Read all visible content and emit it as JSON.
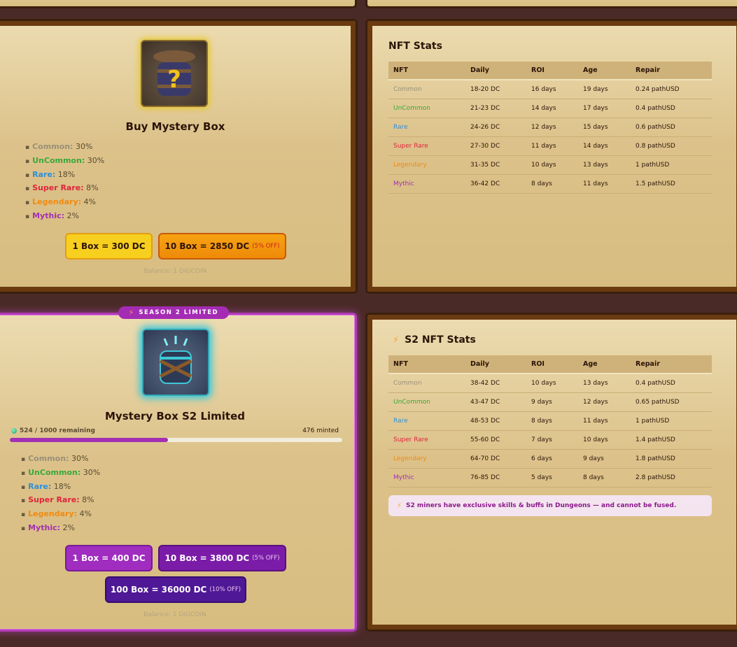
{
  "colors": {
    "common": "#9a9078",
    "uncommon": "#3aa83a",
    "rare": "#2d8fd6",
    "super_rare": "#e0243c",
    "legendary": "#f08a10",
    "mythic": "#a32fb4"
  },
  "box1": {
    "icon": "mystery-barrel-icon",
    "title": "Buy Mystery Box",
    "rarities": [
      {
        "name": "Common:",
        "pct": "30%"
      },
      {
        "name": "UnCommon:",
        "pct": "30%"
      },
      {
        "name": "Rare:",
        "pct": "18%"
      },
      {
        "name": "Super Rare:",
        "pct": "8%"
      },
      {
        "name": "Legendary:",
        "pct": "4%"
      },
      {
        "name": "Mythic:",
        "pct": "2%"
      }
    ],
    "btn_1": "1 Box = 300 DC",
    "btn_10": "10 Box = 2850 DC",
    "btn_10_discount": "(5% OFF)",
    "balance": "Balance: 1 DIGCOIN"
  },
  "stats1": {
    "title": "NFT Stats",
    "headers": [
      "NFT",
      "Daily",
      "ROI",
      "Age",
      "Repair"
    ],
    "rows": [
      [
        "Common",
        "18-20 DC",
        "16 days",
        "19 days",
        "0.24 pathUSD"
      ],
      [
        "UnCommon",
        "21-23 DC",
        "14 days",
        "17 days",
        "0.4 pathUSD"
      ],
      [
        "Rare",
        "24-26 DC",
        "12 days",
        "15 days",
        "0.6 pathUSD"
      ],
      [
        "Super Rare",
        "27-30 DC",
        "11 days",
        "14 days",
        "0.8 pathUSD"
      ],
      [
        "Legendary",
        "31-35 DC",
        "10 days",
        "13 days",
        "1 pathUSD"
      ],
      [
        "Mythic",
        "36-42 DC",
        "8 days",
        "11 days",
        "1.5 pathUSD"
      ]
    ]
  },
  "box2": {
    "badge": "SEASON 2 LIMITED",
    "icon": "chained-barrel-icon",
    "title": "Mystery Box S2 Limited",
    "remaining": "524 / 1000 remaining",
    "minted": "476 minted",
    "progress_fraction": 0.476,
    "rarities": [
      {
        "name": "Common:",
        "pct": "30%"
      },
      {
        "name": "UnCommon:",
        "pct": "30%"
      },
      {
        "name": "Rare:",
        "pct": "18%"
      },
      {
        "name": "Super Rare:",
        "pct": "8%"
      },
      {
        "name": "Legendary:",
        "pct": "4%"
      },
      {
        "name": "Mythic:",
        "pct": "2%"
      }
    ],
    "btn_1": "1 Box = 400 DC",
    "btn_10": "10 Box = 3800 DC",
    "btn_10_discount": "(5% OFF)",
    "btn_100": "100 Box = 36000 DC",
    "btn_100_discount": "(10% OFF)",
    "balance": "Balance: 1 DIGCOIN"
  },
  "stats2": {
    "title": "S2 NFT Stats",
    "headers": [
      "NFT",
      "Daily",
      "ROI",
      "Age",
      "Repair"
    ],
    "rows": [
      [
        "Common",
        "38-42 DC",
        "10 days",
        "13 days",
        "0.4 pathUSD"
      ],
      [
        "UnCommon",
        "43-47 DC",
        "9 days",
        "12 days",
        "0.65 pathUSD"
      ],
      [
        "Rare",
        "48-53 DC",
        "8 days",
        "11 days",
        "1 pathUSD"
      ],
      [
        "Super Rare",
        "55-60 DC",
        "7 days",
        "10 days",
        "1.4 pathUSD"
      ],
      [
        "Legendary",
        "64-70 DC",
        "6 days",
        "9 days",
        "1.8 pathUSD"
      ],
      [
        "Mythic",
        "76-85 DC",
        "5 days",
        "8 days",
        "2.8 pathUSD"
      ]
    ],
    "note": "S2 miners have exclusive skills & buffs in Dungeons — and cannot be fused."
  }
}
